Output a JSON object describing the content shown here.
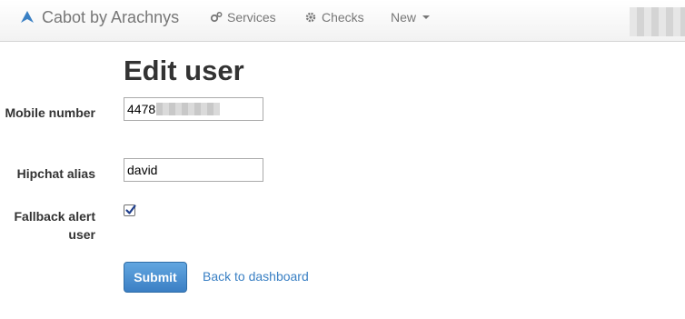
{
  "navbar": {
    "brand": "Cabot by Arachnys",
    "items": [
      {
        "label": "Services",
        "icon": "gears-icon"
      },
      {
        "label": "Checks",
        "icon": "gear-icon"
      },
      {
        "label": "New",
        "icon": "chevron-down-icon"
      }
    ]
  },
  "page": {
    "title": "Edit user"
  },
  "form": {
    "mobile_label": "Mobile number",
    "mobile_value": "4478",
    "hipchat_label": "Hipchat alias",
    "hipchat_value": "david",
    "fallback_label": "Fallback alert user",
    "fallback_checked": true,
    "submit_label": "Submit",
    "back_label": "Back to dashboard"
  },
  "colors": {
    "link": "#3a80c4",
    "button": "#4a8fd3",
    "nav_text": "#777777"
  }
}
